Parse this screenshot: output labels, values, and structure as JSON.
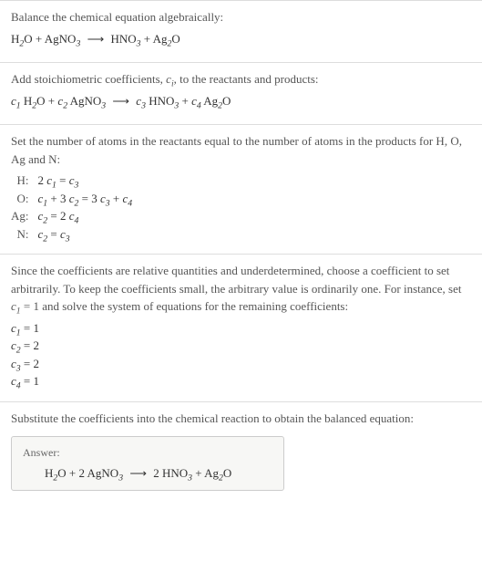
{
  "section1": {
    "intro": "Balance the chemical equation algebraically:",
    "equation_html": "H<span class='sub'>2</span>O + AgNO<span class='sub'>3</span> <span class='arrow'>⟶</span> HNO<span class='sub'>3</span> + Ag<span class='sub'>2</span>O"
  },
  "section2": {
    "intro_html": "Add stoichiometric coefficients, <span class='italic-var'>c<span class='sub'>i</span></span>, to the reactants and products:",
    "equation_html": "<span class='italic-var'>c</span><span class='sub'>1</span> H<span class='sub'>2</span>O + <span class='italic-var'>c</span><span class='sub'>2</span> AgNO<span class='sub'>3</span> <span class='arrow'>⟶</span> <span class='italic-var'>c</span><span class='sub'>3</span> HNO<span class='sub'>3</span> + <span class='italic-var'>c</span><span class='sub'>4</span> Ag<span class='sub'>2</span>O"
  },
  "section3": {
    "intro": "Set the number of atoms in the reactants equal to the number of atoms in the products for H, O, Ag and N:",
    "rows": [
      {
        "label": "H:",
        "eq_html": "2 <span class='italic-var'>c</span><span class='sub'>1</span> = <span class='italic-var'>c</span><span class='sub'>3</span>"
      },
      {
        "label": "O:",
        "eq_html": "<span class='italic-var'>c</span><span class='sub'>1</span> + 3 <span class='italic-var'>c</span><span class='sub'>2</span> = 3 <span class='italic-var'>c</span><span class='sub'>3</span> + <span class='italic-var'>c</span><span class='sub'>4</span>"
      },
      {
        "label": "Ag:",
        "eq_html": "<span class='italic-var'>c</span><span class='sub'>2</span> = 2 <span class='italic-var'>c</span><span class='sub'>4</span>"
      },
      {
        "label": "N:",
        "eq_html": "<span class='italic-var'>c</span><span class='sub'>2</span> = <span class='italic-var'>c</span><span class='sub'>3</span>"
      }
    ]
  },
  "section4": {
    "intro_html": "Since the coefficients are relative quantities and underdetermined, choose a coefficient to set arbitrarily. To keep the coefficients small, the arbitrary value is ordinarily one. For instance, set <span class='italic-var'>c</span><span class='sub'>1</span> = 1 and solve the system of equations for the remaining coefficients:",
    "coeffs": [
      "<span class='italic-var'>c</span><span class='sub'>1</span> = 1",
      "<span class='italic-var'>c</span><span class='sub'>2</span> = 2",
      "<span class='italic-var'>c</span><span class='sub'>3</span> = 2",
      "<span class='italic-var'>c</span><span class='sub'>4</span> = 1"
    ]
  },
  "section5": {
    "intro": "Substitute the coefficients into the chemical reaction to obtain the balanced equation:",
    "answer_label": "Answer:",
    "answer_html": "H<span class='sub'>2</span>O + 2 AgNO<span class='sub'>3</span> <span class='arrow'>⟶</span> 2 HNO<span class='sub'>3</span> + Ag<span class='sub'>2</span>O"
  }
}
